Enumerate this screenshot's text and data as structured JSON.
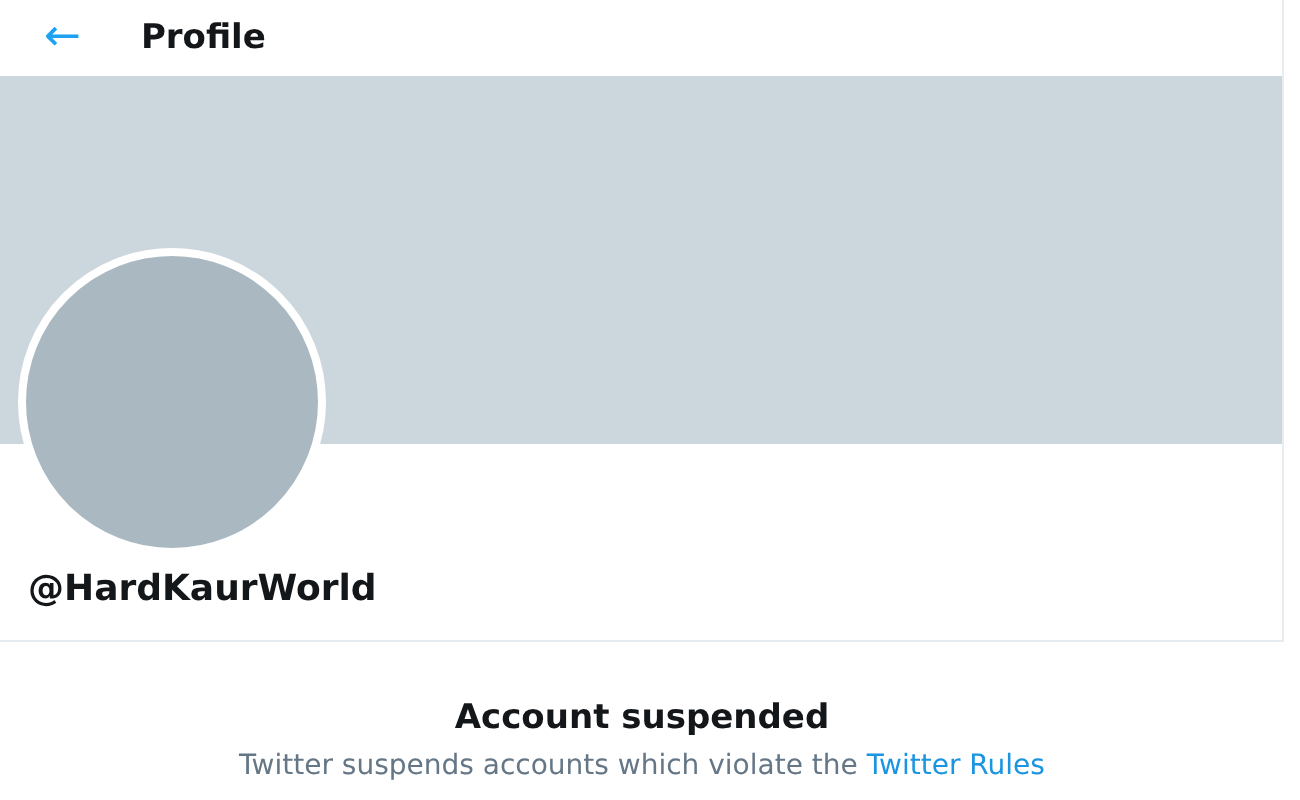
{
  "header": {
    "back_icon": "←",
    "title": "Profile"
  },
  "profile": {
    "banner": {
      "kind": "blank"
    },
    "avatar": {
      "kind": "blank"
    },
    "handle": "@HardKaurWorld"
  },
  "notice": {
    "title": "Account suspended",
    "text": "Twitter suspends accounts which violate the",
    "link": "Twitter Rules"
  }
}
